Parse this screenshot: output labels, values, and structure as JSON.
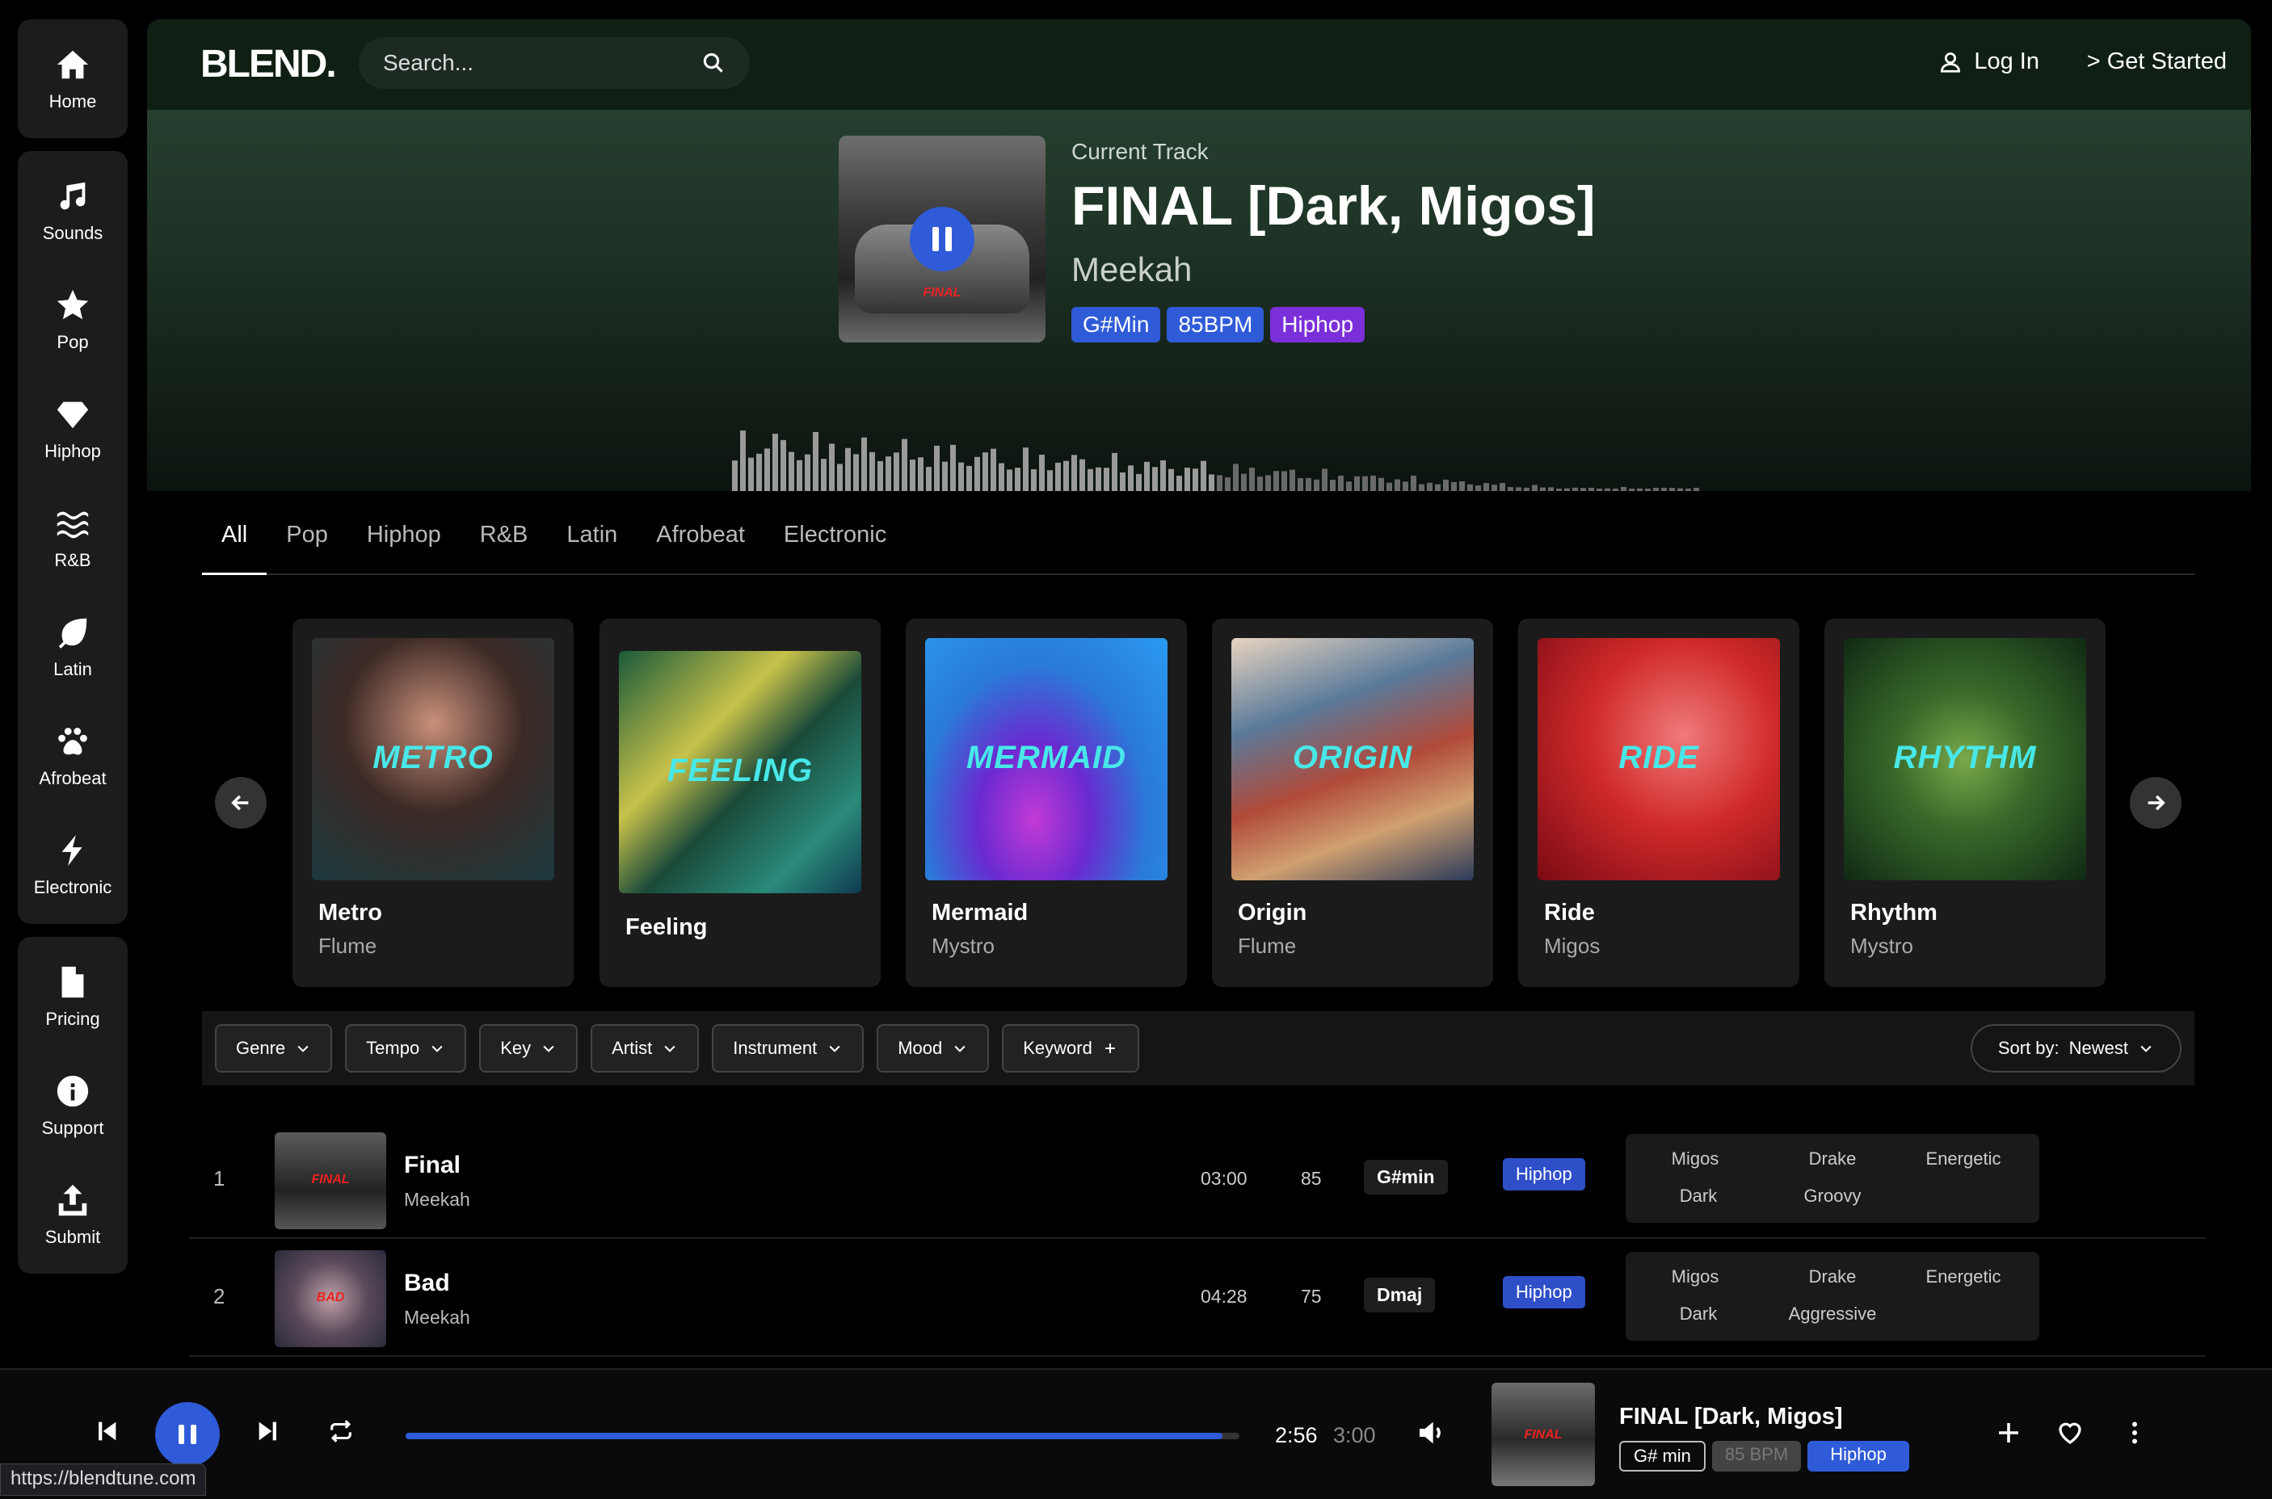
{
  "sidebar": {
    "home": "Home",
    "sounds": "Sounds",
    "pop": "Pop",
    "hiphop": "Hiphop",
    "rnb": "R&B",
    "latin": "Latin",
    "afrobeat": "Afrobeat",
    "electronic": "Electronic",
    "pricing": "Pricing",
    "support": "Support",
    "submit": "Submit"
  },
  "header": {
    "logo": "BLEND.",
    "search_placeholder": "Search...",
    "login": "Log In",
    "get_started": "> Get Started"
  },
  "current_track": {
    "label": "Current Track",
    "title": "FINAL [Dark, Migos]",
    "artist": "Meekah",
    "cover_text": "FINAL",
    "tags": {
      "key": "G#Min",
      "bpm": "85BPM",
      "genre": "Hiphop"
    }
  },
  "genre_tabs": [
    "All",
    "Pop",
    "Hiphop",
    "R&B",
    "Latin",
    "Afrobeat",
    "Electronic"
  ],
  "cards": [
    {
      "word": "METRO",
      "name": "Metro",
      "artist": "Flume"
    },
    {
      "word": "FEELING",
      "name": "Feeling",
      "artist": ""
    },
    {
      "word": "MERMAID",
      "name": "Mermaid",
      "artist": "Mystro"
    },
    {
      "word": "ORIGIN",
      "name": "Origin",
      "artist": "Flume"
    },
    {
      "word": "RIDE",
      "name": "Ride",
      "artist": "Migos"
    },
    {
      "word": "RHYTHM",
      "name": "Rhythm",
      "artist": "Mystro"
    }
  ],
  "filters": {
    "genre": "Genre",
    "tempo": "Tempo",
    "key": "Key",
    "artist": "Artist",
    "instrument": "Instrument",
    "mood": "Mood",
    "keyword": "Keyword",
    "sort_label": "Sort by:",
    "sort_value": "Newest"
  },
  "tracks": [
    {
      "num": "1",
      "cover_text": "FINAL",
      "title": "Final",
      "artist": "Meekah",
      "duration": "03:00",
      "bpm": "85",
      "key": "G#min",
      "genre": "Hiphop",
      "tags": [
        "Migos",
        "Drake",
        "Energetic",
        "Dark",
        "Groovy"
      ]
    },
    {
      "num": "2",
      "cover_text": "BAD",
      "title": "Bad",
      "artist": "Meekah",
      "duration": "04:28",
      "bpm": "75",
      "key": "Dmaj",
      "genre": "Hiphop",
      "tags": [
        "Migos",
        "Drake",
        "Energetic",
        "Dark",
        "Aggressive"
      ]
    }
  ],
  "player": {
    "progress": 0.98,
    "time_current": "2:56",
    "time_total": "3:00",
    "title": "FINAL [Dark, Migos]",
    "cover_text": "FINAL",
    "key": "G# min",
    "bpm": "85 BPM",
    "genre": "Hiphop"
  },
  "status_url": "https://blendtune.com"
}
